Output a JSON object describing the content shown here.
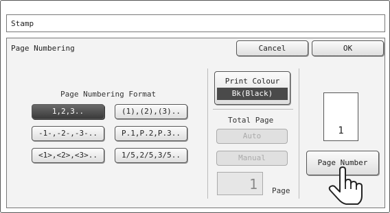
{
  "window": {
    "title": "Stamp"
  },
  "header": {
    "title": "Page Numbering",
    "cancel_label": "Cancel",
    "ok_label": "OK"
  },
  "format": {
    "label": "Page Numbering Format",
    "options": [
      "1,2,3..",
      "(1),(2),(3)..",
      "-1-,-2-,-3-..",
      "P.1,P.2,P.3..",
      "<1>,<2>,<3>..",
      "1/5,2/5,3/5.."
    ],
    "selected": "1,2,3.."
  },
  "colour": {
    "label": "Print Colour",
    "value": "Bk(Black)"
  },
  "total_page": {
    "label": "Total Page",
    "auto_label": "Auto",
    "manual_label": "Manual",
    "value": "1",
    "unit": "Page"
  },
  "preview": {
    "number": "1",
    "button_label": "Page Number"
  },
  "icons": {
    "pointer": "hand-pointer-icon"
  },
  "colors": {
    "selected": "#4a4a4a",
    "disabled_text": "#aaaaaa"
  }
}
